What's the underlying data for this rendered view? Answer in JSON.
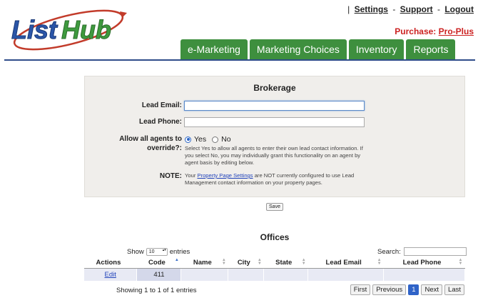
{
  "header": {
    "logo_text": "ListHub",
    "links": [
      {
        "label": "Settings"
      },
      {
        "label": "Support"
      },
      {
        "label": "Logout"
      }
    ],
    "leading_separator": "|",
    "separator": "-",
    "purchase_label": "Purchase:",
    "purchase_plan": "Pro-Plus"
  },
  "tabs": [
    {
      "label": "e-Marketing"
    },
    {
      "label": "Marketing Choices"
    },
    {
      "label": "Inventory"
    },
    {
      "label": "Reports"
    }
  ],
  "brokerage": {
    "title": "Brokerage",
    "lead_email_label": "Lead Email:",
    "lead_email_value": "",
    "lead_phone_label": "Lead Phone:",
    "lead_phone_value": "",
    "override_label_1": "Allow all agents to",
    "override_label_2": "override?:",
    "yes_label": "Yes",
    "no_label": "No",
    "override_selected": "Yes",
    "help_text": "Select Yes to allow all agents to enter their own lead contact information. If you select No, you may individually grant this functionality on an agent by agent basis by editing below.",
    "note_label": "NOTE:",
    "note_prefix": "Your",
    "note_link": "Property Page Settings",
    "note_suffix": "are NOT currently configured to use Lead Management contact information on your property pages.",
    "save_label": "Save"
  },
  "offices": {
    "title": "Offices",
    "show_label": "Show",
    "entries_value": "10",
    "entries_label": "entries",
    "search_label": "Search:",
    "columns": [
      "Actions",
      "Code",
      "Name",
      "City",
      "State",
      "Lead Email",
      "Lead Phone"
    ],
    "rows": [
      {
        "action": "Edit",
        "code": "411",
        "name": "",
        "city": "",
        "state": "",
        "lead_email": "",
        "lead_phone": ""
      }
    ],
    "showing_text": "Showing 1 to 1 of 1 entries",
    "pager": {
      "first": "First",
      "previous": "Previous",
      "current": "1",
      "next": "Next",
      "last": "Last"
    }
  },
  "colors": {
    "tab_green": "#3e8f3e",
    "header_rule": "#2f4d8a",
    "purchase_red": "#cc2222",
    "link_blue": "#2244bb",
    "logo_blue": "#2a55a8",
    "logo_green": "#3e9a3e"
  }
}
